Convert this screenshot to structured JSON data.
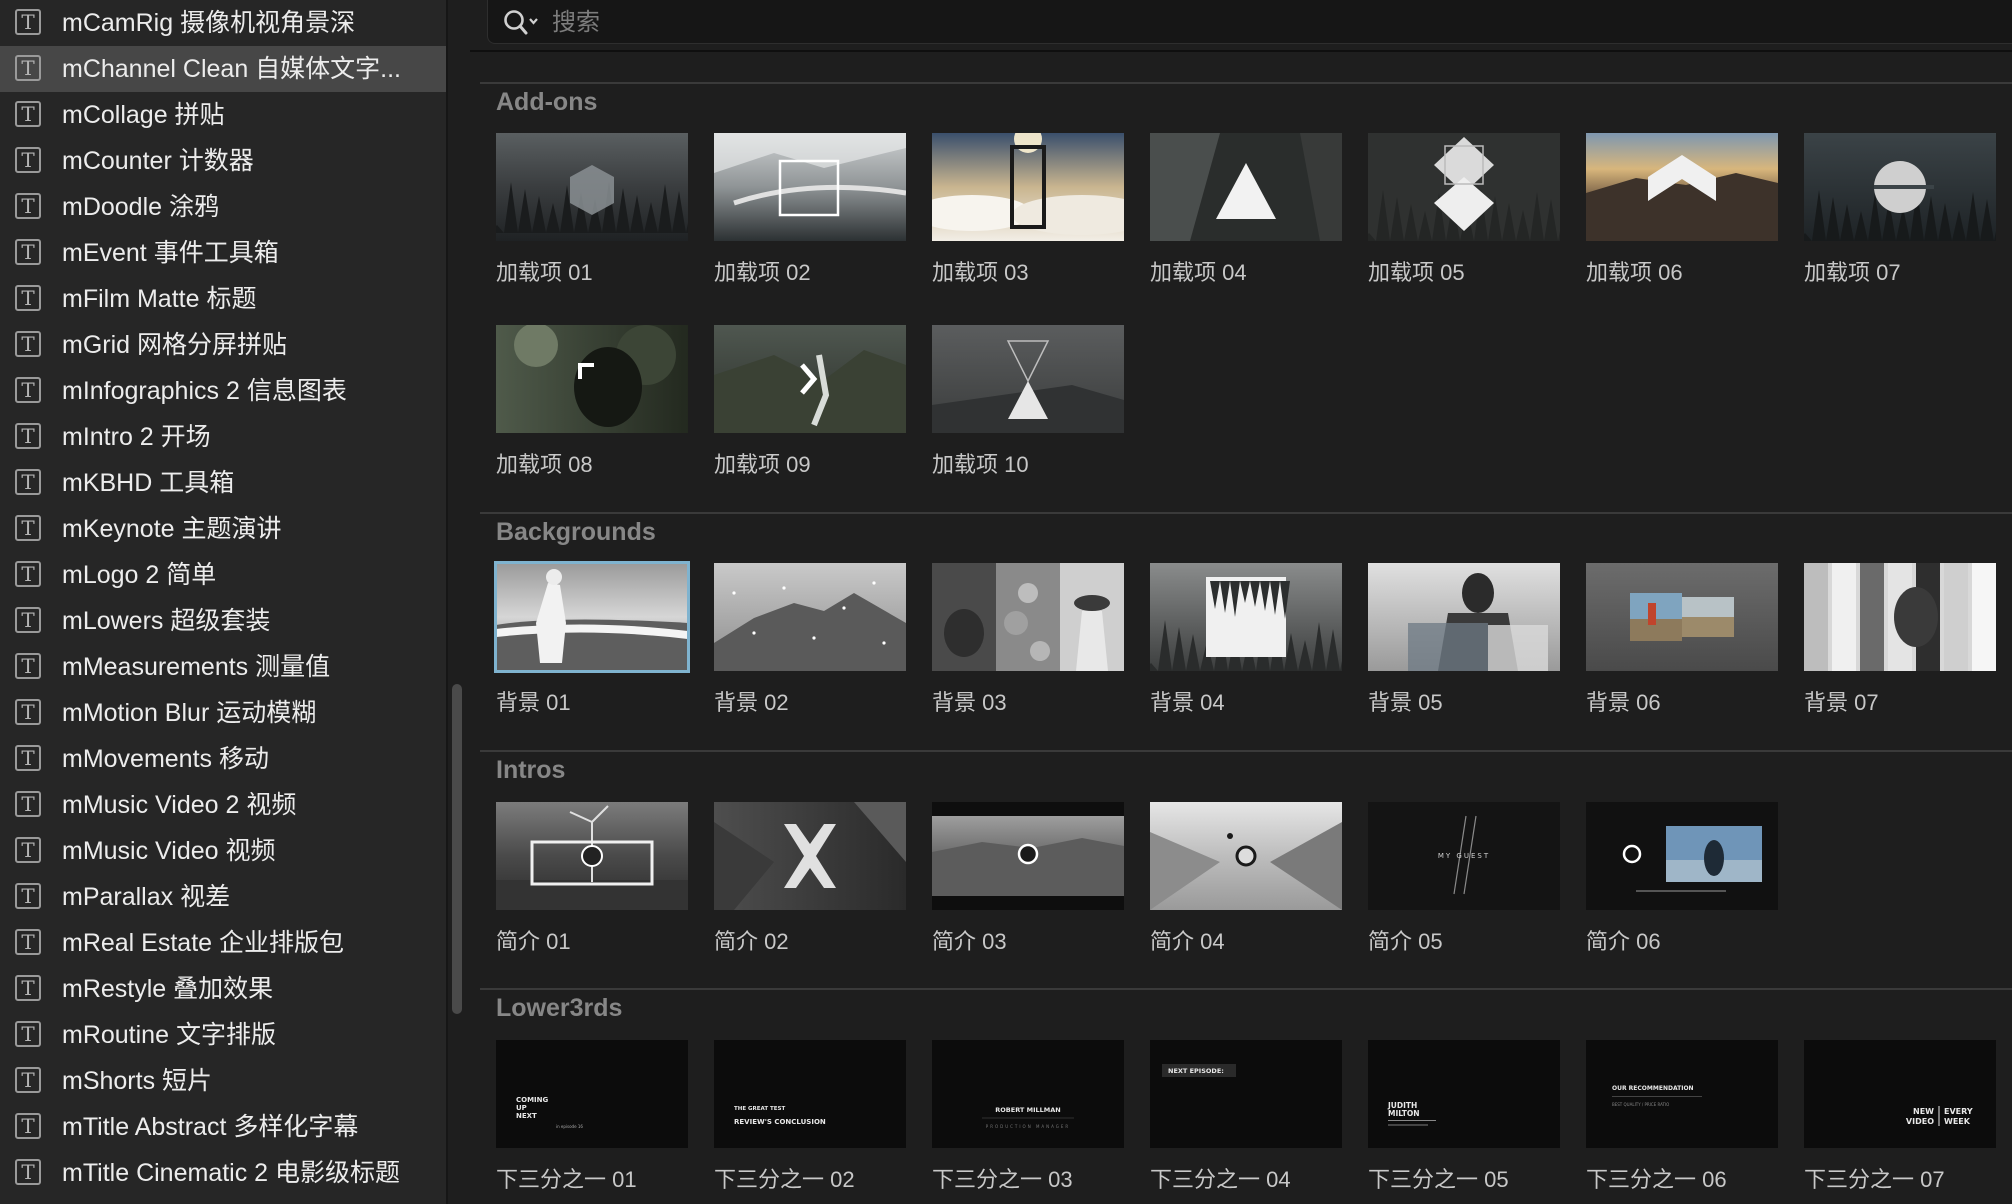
{
  "search": {
    "placeholder": "搜索",
    "value": ""
  },
  "sidebar": {
    "items": [
      {
        "icon": "T",
        "label": "mCamRig 摄像机视角景深"
      },
      {
        "icon": "T",
        "label": "mChannel Clean 自媒体文字...",
        "selected": true
      },
      {
        "icon": "T",
        "label": "mCollage 拼贴"
      },
      {
        "icon": "T",
        "label": "mCounter 计数器"
      },
      {
        "icon": "T",
        "label": "mDoodle 涂鸦"
      },
      {
        "icon": "T",
        "label": "mEvent 事件工具箱"
      },
      {
        "icon": "T",
        "label": "mFilm Matte 标题"
      },
      {
        "icon": "T",
        "label": "mGrid 网格分屏拼贴"
      },
      {
        "icon": "T",
        "label": "mInfographics 2 信息图表"
      },
      {
        "icon": "T",
        "label": "mIntro 2 开场"
      },
      {
        "icon": "T",
        "label": "mKBHD 工具箱"
      },
      {
        "icon": "T",
        "label": "mKeynote 主题演讲"
      },
      {
        "icon": "T",
        "label": "mLogo 2 简单"
      },
      {
        "icon": "T",
        "label": "mLowers 超级套装"
      },
      {
        "icon": "T",
        "label": "mMeasurements 测量值"
      },
      {
        "icon": "T",
        "label": "mMotion Blur 运动模糊"
      },
      {
        "icon": "T",
        "label": "mMovements 移动"
      },
      {
        "icon": "T",
        "label": "mMusic Video 2 视频"
      },
      {
        "icon": "T",
        "label": "mMusic Video 视频"
      },
      {
        "icon": "T",
        "label": "mParallax 视差"
      },
      {
        "icon": "T",
        "label": "mReal Estate 企业排版包"
      },
      {
        "icon": "T",
        "label": "mRestyle 叠加效果"
      },
      {
        "icon": "T",
        "label": "mRoutine 文字排版"
      },
      {
        "icon": "T",
        "label": "mShorts 短片"
      },
      {
        "icon": "T",
        "label": "mTitle Abstract 多样化字幕"
      },
      {
        "icon": "T",
        "label": "mTitle Cinematic 2 电影级标题"
      }
    ]
  },
  "sections": [
    {
      "title": "Add-ons",
      "items": [
        {
          "label": "加载项 01",
          "thumb": "hexagon"
        },
        {
          "label": "加载项 02",
          "thumb": "bridge-frame"
        },
        {
          "label": "加载项 03",
          "thumb": "clouds-frame"
        },
        {
          "label": "加载项 04",
          "thumb": "triangle"
        },
        {
          "label": "加载项 05",
          "thumb": "diamonds"
        },
        {
          "label": "加载项 06",
          "thumb": "chevron-mountain"
        },
        {
          "label": "加载项 07",
          "thumb": "circle-bridge"
        },
        {
          "label": "加载项 08",
          "thumb": "corner-bracket"
        },
        {
          "label": "加载项 09",
          "thumb": "arrow-right"
        },
        {
          "label": "加载项 10",
          "thumb": "hourglass"
        }
      ]
    },
    {
      "title": "Backgrounds",
      "items": [
        {
          "label": "背景 01",
          "thumb": "bw-figure",
          "selected": true
        },
        {
          "label": "背景 02",
          "thumb": "bw-mountain"
        },
        {
          "label": "背景 03",
          "thumb": "bw-collage"
        },
        {
          "label": "背景 04",
          "thumb": "bw-forest"
        },
        {
          "label": "背景 05",
          "thumb": "bw-blur"
        },
        {
          "label": "背景 06",
          "thumb": "color-photo"
        },
        {
          "label": "背景 07",
          "thumb": "bw-slices"
        }
      ]
    },
    {
      "title": "Intros",
      "items": [
        {
          "label": "简介 01",
          "thumb": "windmill-logo"
        },
        {
          "label": "简介 02",
          "thumb": "x-logo"
        },
        {
          "label": "简介 03",
          "thumb": "landscape-logo"
        },
        {
          "label": "简介 04",
          "thumb": "valley-logo"
        },
        {
          "label": "简介 05",
          "thumb": "my-guest"
        },
        {
          "label": "简介 06",
          "thumb": "dark-logo-photo"
        }
      ]
    },
    {
      "title": "Lower3rds",
      "items": [
        {
          "label": "下三分之一 01",
          "thumb": "lt1",
          "text": [
            "COMING",
            "UP",
            "NEXT"
          ],
          "subtext": "in episode 16"
        },
        {
          "label": "下三分之一 02",
          "thumb": "lt2",
          "text": [
            "THE GREAT TEST",
            "REVIEW'S CONCLUSION"
          ]
        },
        {
          "label": "下三分之一 03",
          "thumb": "lt3",
          "text": [
            "ROBERT MILLMAN",
            "PRODUCTION MANAGER"
          ]
        },
        {
          "label": "下三分之一 04",
          "thumb": "lt4",
          "text": [
            "NEXT EPISODE:"
          ]
        },
        {
          "label": "下三分之一 05",
          "thumb": "lt5",
          "text": [
            "JUDITH",
            "MILTON"
          ]
        },
        {
          "label": "下三分之一 06",
          "thumb": "lt6",
          "text": [
            "OUR RECOMMENDATION",
            "BEST QUALITY / PRICE RATIO"
          ]
        },
        {
          "label": "下三分之一 07",
          "thumb": "lt7",
          "text": [
            "NEW",
            "VIDEO",
            "EVERY",
            "WEEK"
          ]
        }
      ]
    }
  ],
  "colors": {
    "sidebar_bg": "#262626",
    "selected_row": "#474747",
    "main_bg": "#1e1e1e",
    "selection_outline": "#7fb3cf",
    "section_title": "#878787"
  }
}
